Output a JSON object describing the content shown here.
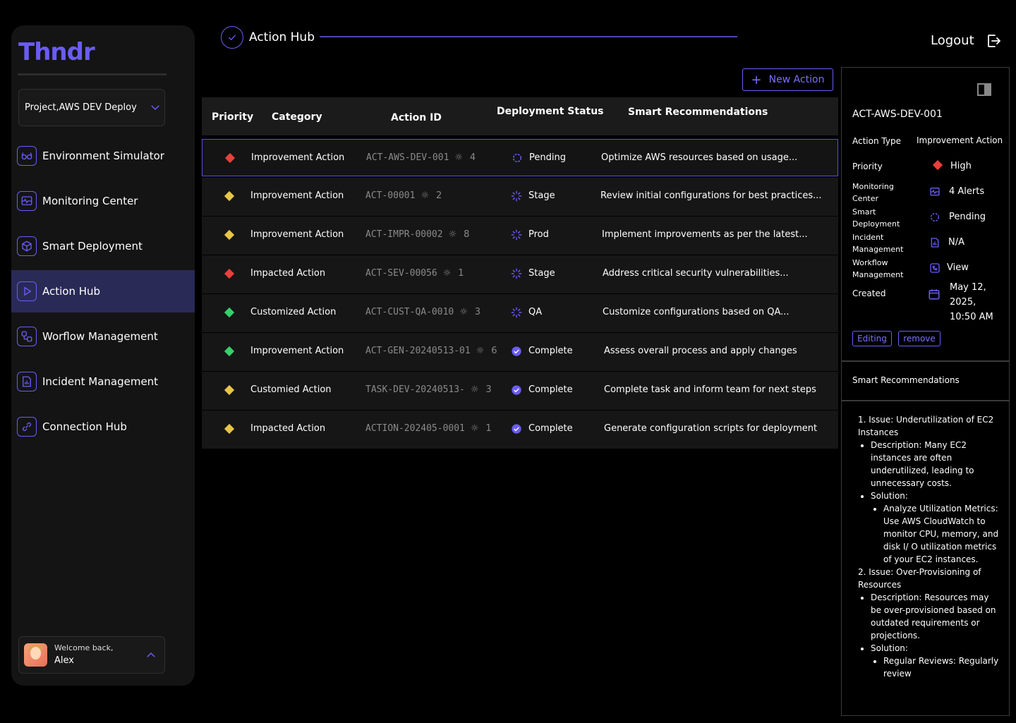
{
  "brand": {
    "logo_text": "Thndr"
  },
  "project_select": {
    "value": "Project,AWS DEV Deploy"
  },
  "nav": [
    {
      "label": "Environment Simulator",
      "icon": "glasses-icon"
    },
    {
      "label": "Monitoring Center",
      "icon": "monitor-icon"
    },
    {
      "label": "Smart Deployment",
      "icon": "cube-icon"
    },
    {
      "label": "Action Hub",
      "icon": "play-icon",
      "active": true
    },
    {
      "label": "Worflow Management",
      "icon": "workflow-icon"
    },
    {
      "label": "Incident Management",
      "icon": "report-icon"
    },
    {
      "label": "Connection Hub",
      "icon": "link-icon"
    }
  ],
  "user": {
    "welcome": "Welcome back,",
    "name": "Alex"
  },
  "header": {
    "title": "Action Hub",
    "logout": "Logout"
  },
  "toolbar": {
    "new_action": "New Action"
  },
  "table": {
    "headers": [
      "Priority",
      "Category",
      "Action ID",
      "Deployment Status",
      "Smart Recommendations"
    ],
    "rows": [
      {
        "priority": "red",
        "category": "Improvement Action",
        "id": "ACT-AWS-DEV-001",
        "bugs": "4",
        "status": "Pending",
        "status_type": "pending",
        "rec": "Optimize AWS resources based on usage..."
      },
      {
        "priority": "yellow",
        "category": "Improvement Action",
        "id": "ACT-00001",
        "bugs": "2",
        "status": "Stage",
        "status_type": "loading",
        "rec": "Review initial configurations for best practices..."
      },
      {
        "priority": "yellow",
        "category": "Improvement Action",
        "id": "ACT-IMPR-00002",
        "bugs": "8",
        "status": "Prod",
        "status_type": "loading",
        "rec": "Implement improvements as per the latest..."
      },
      {
        "priority": "red",
        "category": "Impacted Action",
        "id": "ACT-SEV-00056",
        "bugs": "1",
        "status": "Stage",
        "status_type": "loading",
        "rec": "Address critical security vulnerabilities..."
      },
      {
        "priority": "green",
        "category": "Customized Action",
        "id": "ACT-CUST-QA-0010",
        "bugs": "3",
        "status": "QA",
        "status_type": "loading",
        "rec": "Customize configurations based on QA..."
      },
      {
        "priority": "green",
        "category": "Improvement Action",
        "id": "ACT-GEN-20240513-01",
        "bugs": "6",
        "status": "Complete",
        "status_type": "complete",
        "rec": "Assess overall process and apply changes"
      },
      {
        "priority": "yellow",
        "category": "Customied Action",
        "id": "TASK-DEV-20240513-",
        "bugs": "3",
        "status": "Complete",
        "status_type": "complete",
        "rec": "Complete task and inform team for next steps"
      },
      {
        "priority": "yellow",
        "category": "Impacted Action",
        "id": "ACTION-202405-0001",
        "bugs": "1",
        "status": "Complete",
        "status_type": "complete",
        "rec": "Generate configuration scripts for deployment"
      }
    ]
  },
  "colors": {
    "red": "#e8403a",
    "yellow": "#e8c547",
    "green": "#35d16a",
    "accent": "#6a5cf5"
  },
  "panel": {
    "id": "ACT-AWS-DEV-001",
    "action_type_label": "Action Type",
    "action_type_value": "Improvement Action",
    "priority_label": "Priority",
    "priority_value": "High",
    "monitoring_label_1": "Monitoring",
    "monitoring_label_2": "Center",
    "monitoring_value": "4 Alerts",
    "smart_label_1": "Smart",
    "smart_label_2": "Deployment",
    "smart_value": "Pending",
    "incident_label_1": "Incident",
    "incident_label_2": "Management",
    "incident_value": "N/A",
    "workflow_label_1": "Workflow",
    "workflow_label_2": "Management",
    "workflow_value": "View",
    "created_label": "Created",
    "created_value_1": "May 12, 2025,",
    "created_value_2": "10:50 AM",
    "editing": "Editing",
    "remove": "remove",
    "section_title": "Smart Recommendations",
    "rec1_title": "1. Issue: Underutilization of EC2 Instances",
    "rec1_desc": "Description: Many EC2 instances are often underutilized, leading to unnecessary costs.",
    "rec1_sol": "Solution:",
    "rec1_sol1": "Analyze Utilization Metrics: Use AWS CloudWatch to monitor CPU, memory, and disk I/ O utilization metrics of your EC2 instances.",
    "rec2_title": "2. Issue: Over-Provisioning of Resources",
    "rec2_desc": "Description: Resources may be over-provisioned based on outdated requirements or projections.",
    "rec2_sol": "Solution:",
    "rec2_sol1": "Regular Reviews: Regularly review"
  }
}
